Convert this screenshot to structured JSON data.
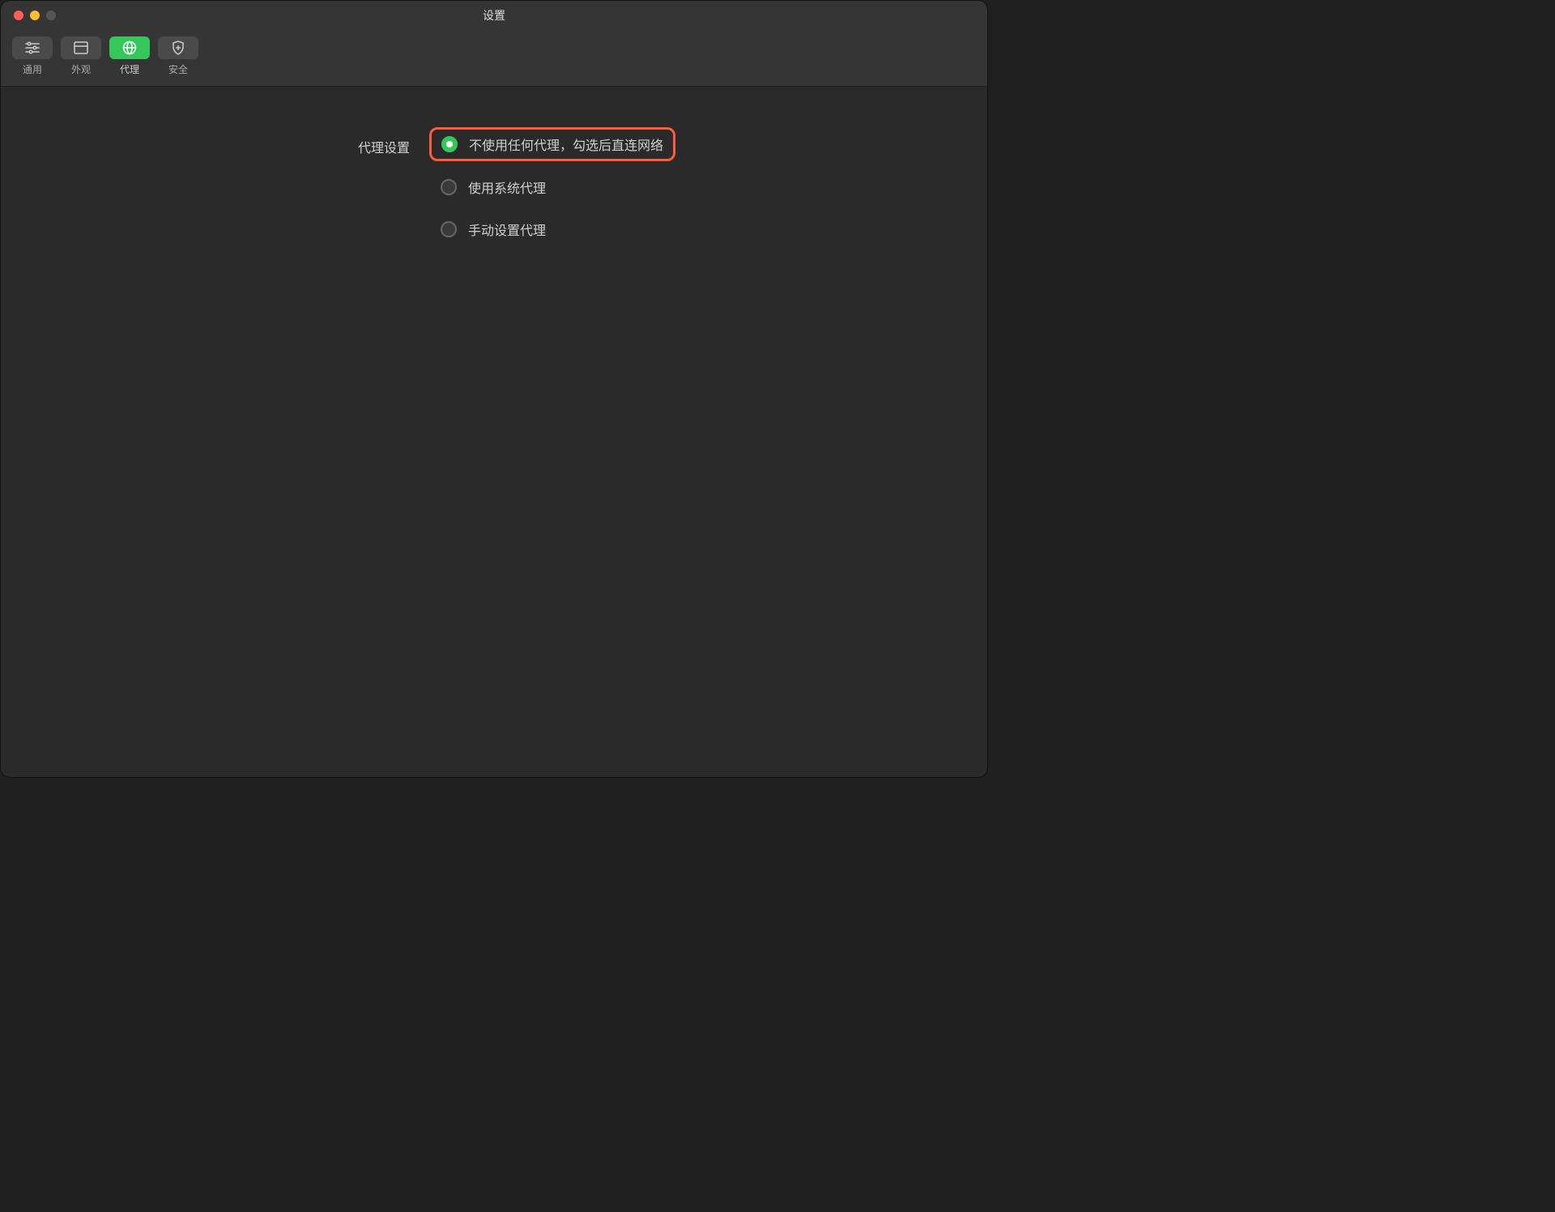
{
  "window": {
    "title": "设置"
  },
  "toolbar": {
    "items": [
      {
        "id": "general",
        "label": "通用",
        "icon": "sliders-icon",
        "active": false
      },
      {
        "id": "appearance",
        "label": "外观",
        "icon": "layout-icon",
        "active": false
      },
      {
        "id": "proxy",
        "label": "代理",
        "icon": "globe-icon",
        "active": true
      },
      {
        "id": "security",
        "label": "安全",
        "icon": "shield-icon",
        "active": false
      }
    ]
  },
  "content": {
    "section_label": "代理设置",
    "radio_options": [
      {
        "id": "no-proxy",
        "label": "不使用任何代理，勾选后直连网络",
        "selected": true,
        "highlighted": true
      },
      {
        "id": "system-proxy",
        "label": "使用系统代理",
        "selected": false,
        "highlighted": false
      },
      {
        "id": "manual-proxy",
        "label": "手动设置代理",
        "selected": false,
        "highlighted": false
      }
    ]
  },
  "colors": {
    "accent": "#34c759",
    "highlight_border": "#ff5a3c",
    "background": "#2a2a2a",
    "toolbar_bg": "#353535"
  }
}
